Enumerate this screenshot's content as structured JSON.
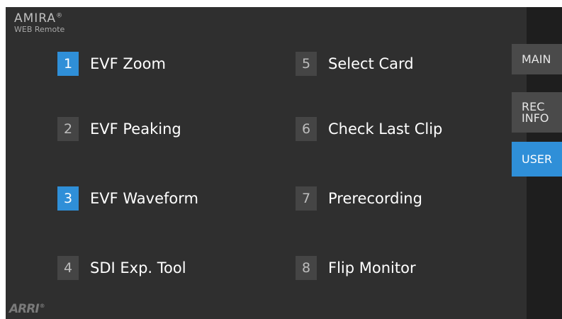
{
  "brand": {
    "logo": "AMIRA",
    "logo_mark": "®",
    "subtitle": "WEB Remote"
  },
  "footer_logo": {
    "text": "ARRI",
    "mark": "®"
  },
  "user_buttons": [
    {
      "number": "1",
      "label": "EVF Zoom",
      "active": true
    },
    {
      "number": "2",
      "label": "EVF Peaking",
      "active": false
    },
    {
      "number": "3",
      "label": "EVF Waveform",
      "active": true
    },
    {
      "number": "4",
      "label": "SDI Exp. Tool",
      "active": false
    },
    {
      "number": "5",
      "label": "Select Card",
      "active": false
    },
    {
      "number": "6",
      "label": "Check Last Clip",
      "active": false
    },
    {
      "number": "7",
      "label": "Prerecording",
      "active": false
    },
    {
      "number": "8",
      "label": "Flip Monitor",
      "active": false
    }
  ],
  "tabs": [
    {
      "label": "MAIN",
      "active": false
    },
    {
      "label_line1": "REC",
      "label_line2": "INFO",
      "active": false
    },
    {
      "label": "USER",
      "active": true
    }
  ],
  "colors": {
    "accent": "#2f8fd8",
    "background": "#2f2f2f",
    "sidebar": "#1e1e1e",
    "tile": "#454545"
  }
}
